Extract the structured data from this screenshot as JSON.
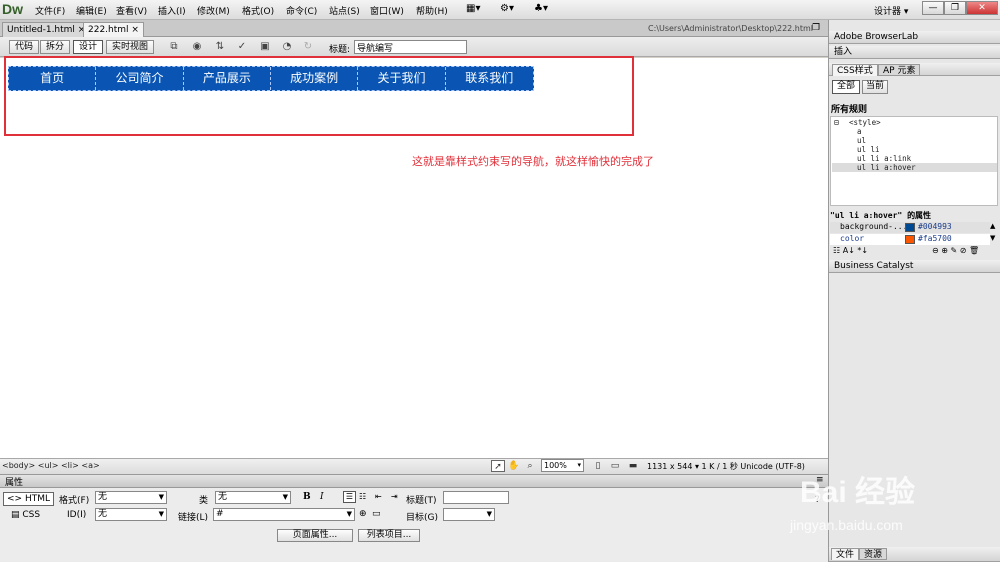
{
  "app": {
    "logo": "Dw",
    "menu": [
      "文件(F)",
      "编辑(E)",
      "查看(V)",
      "插入(I)",
      "修改(M)",
      "格式(O)",
      "命令(C)",
      "站点(S)",
      "窗口(W)",
      "帮助(H)"
    ],
    "workspace": "设计器 ▾"
  },
  "tabs": [
    {
      "label": "Untitled-1.html ×",
      "active": false
    },
    {
      "label": "222.html ×",
      "active": true
    }
  ],
  "file_path": "C:\\Users\\Administrator\\Desktop\\222.html",
  "doc_toolbar": {
    "views": [
      {
        "label": "代码",
        "active": false
      },
      {
        "label": "拆分",
        "active": false
      },
      {
        "label": "设计",
        "active": true
      },
      {
        "label": "实时视图",
        "active": false
      }
    ],
    "title_label": "标题:",
    "title_value": "导航编写"
  },
  "nav": {
    "items": [
      "首页",
      "公司简介",
      "产品展示",
      "成功案例",
      "关于我们",
      "联系我们"
    ],
    "bg_color": "#0a55b4"
  },
  "annotation": "这就是靠样式约束写的导航，就这样愉快的完成了",
  "status_bar": {
    "tag_path": "<body> <ul> <li> <a>",
    "zoom": "100%",
    "dimensions": "1131 x 544 ▾ 1 K / 1 秒 Unicode (UTF-8)"
  },
  "properties": {
    "title": "属性",
    "html_btn": "<> HTML",
    "css_btn": "CSS",
    "format_label": "格式(F)",
    "format_value": "无",
    "class_label": "类",
    "class_value": "无",
    "id_label": "ID(I)",
    "id_value": "无",
    "link_label": "链接(L)",
    "link_value": "#",
    "bold": "B",
    "italic": "I",
    "heading_label": "标题(T)",
    "target_label": "目标(G)",
    "page_props_btn": "页面属性...",
    "list_item_btn": "列表项目..."
  },
  "right_panel": {
    "browserlab": "Adobe BrowserLab",
    "insert_tab": "插入",
    "css_tab": "CSS样式",
    "ap_tab": "AP 元素",
    "all_btn": "全部",
    "current_btn": "当前",
    "all_rules_label": "所有规则",
    "rules": [
      "<style>",
      "a",
      "ul",
      "ul li",
      "ul li a:link",
      "ul li a:hover"
    ],
    "props_title": "\"ul li a:hover\" 的属性",
    "props": [
      {
        "name": "background-...",
        "value": "#004993",
        "color": "#004993"
      },
      {
        "name": "color",
        "value": "#fa5700",
        "color": "#fa5700"
      }
    ],
    "business_catalyst": "Business Catalyst",
    "files_tab": "文件",
    "assets_tab": "资源"
  },
  "watermark": {
    "brand": "Bai 经验",
    "url": "jingyan.baidu.com"
  }
}
